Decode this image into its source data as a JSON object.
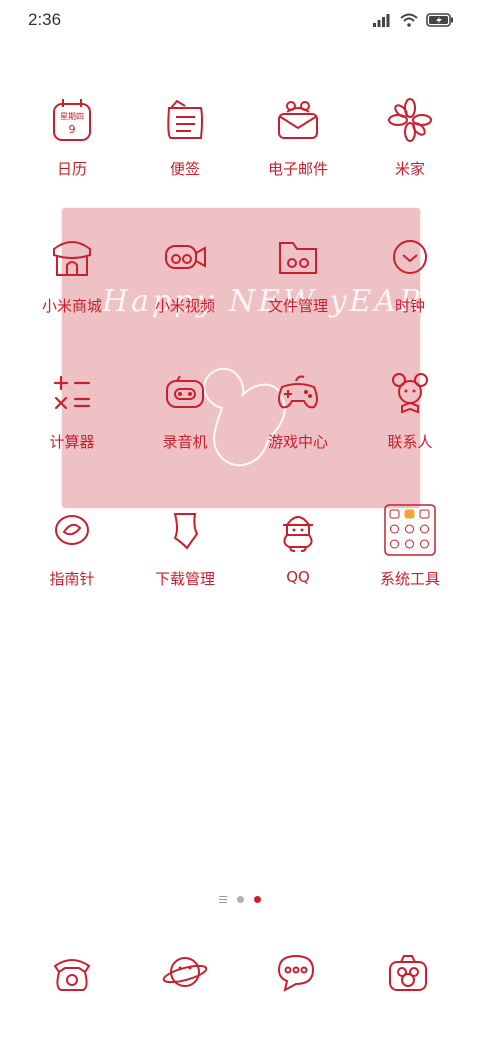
{
  "status_bar": {
    "time": "2:36",
    "icons": [
      "signal-icon",
      "wifi-icon",
      "battery-charging-icon"
    ]
  },
  "widget": {
    "text": "Happy NEW yEAR",
    "background": "#eec1c5"
  },
  "apps": [
    {
      "label": "日历",
      "icon": "calendar-icon",
      "calendar_weekday": "星期四",
      "calendar_day": "9"
    },
    {
      "label": "便签",
      "icon": "notes-icon"
    },
    {
      "label": "电子邮件",
      "icon": "email-icon"
    },
    {
      "label": "米家",
      "icon": "mijia-flower-icon"
    },
    {
      "label": "小米商城",
      "icon": "mall-shop-icon"
    },
    {
      "label": "小米视频",
      "icon": "video-camera-icon"
    },
    {
      "label": "文件管理",
      "icon": "folder-icon"
    },
    {
      "label": "时钟",
      "icon": "clock-icon"
    },
    {
      "label": "计算器",
      "icon": "calculator-icon"
    },
    {
      "label": "录音机",
      "icon": "recorder-icon"
    },
    {
      "label": "游戏中心",
      "icon": "gamepad-icon"
    },
    {
      "label": "联系人",
      "icon": "contacts-icon"
    },
    {
      "label": "指南针",
      "icon": "compass-icon"
    },
    {
      "label": "下载管理",
      "icon": "download-icon"
    },
    {
      "label": "QQ",
      "icon": "qq-penguin-icon"
    },
    {
      "label": "系统工具",
      "icon": "system-tools-folder-icon"
    }
  ],
  "page_indicator": {
    "pages": 3,
    "active": 3
  },
  "dock": [
    {
      "icon": "phone-icon"
    },
    {
      "icon": "browser-planet-icon"
    },
    {
      "icon": "messages-icon"
    },
    {
      "icon": "camera-icon"
    }
  ],
  "colors": {
    "accent": "#c8202f",
    "widget": "#eec1c5",
    "background": "#ffffff"
  }
}
